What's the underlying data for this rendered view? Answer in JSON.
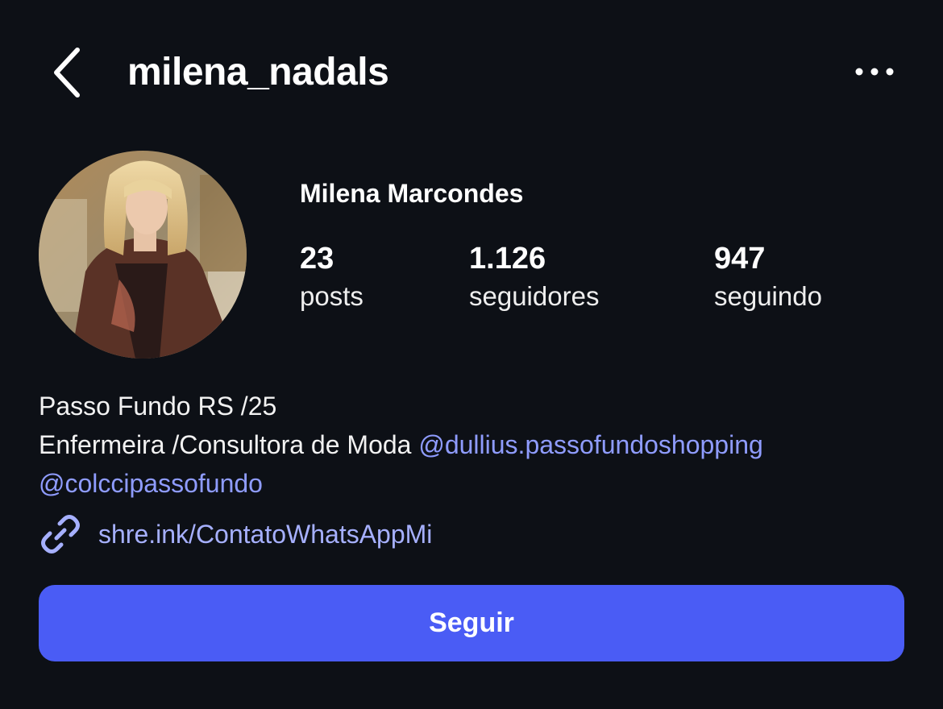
{
  "header": {
    "username": "milena_nadals",
    "back_icon": "chevron-left-icon",
    "more_icon": "more-horizontal-icon"
  },
  "profile": {
    "full_name": "Milena Marcondes",
    "stats": [
      {
        "value": "23",
        "label": "posts"
      },
      {
        "value": "1.126",
        "label": "seguidores"
      },
      {
        "value": "947",
        "label": "seguindo"
      }
    ]
  },
  "bio": {
    "line1": "Passo Fundo RS /25",
    "line2_text": "Enfermeira /Consultora de Moda ",
    "mention1": "@dullius.passofundoshopping",
    "mention2": "@colccipassofundo"
  },
  "link": {
    "icon": "link-icon",
    "text": "shre.ink/ContatoWhatsAppMi"
  },
  "actions": {
    "follow_label": "Seguir"
  },
  "colors": {
    "background": "#0d1016",
    "accent_button": "#4a5cf5",
    "mention": "#8f9cff",
    "link": "#a6b0ff"
  }
}
